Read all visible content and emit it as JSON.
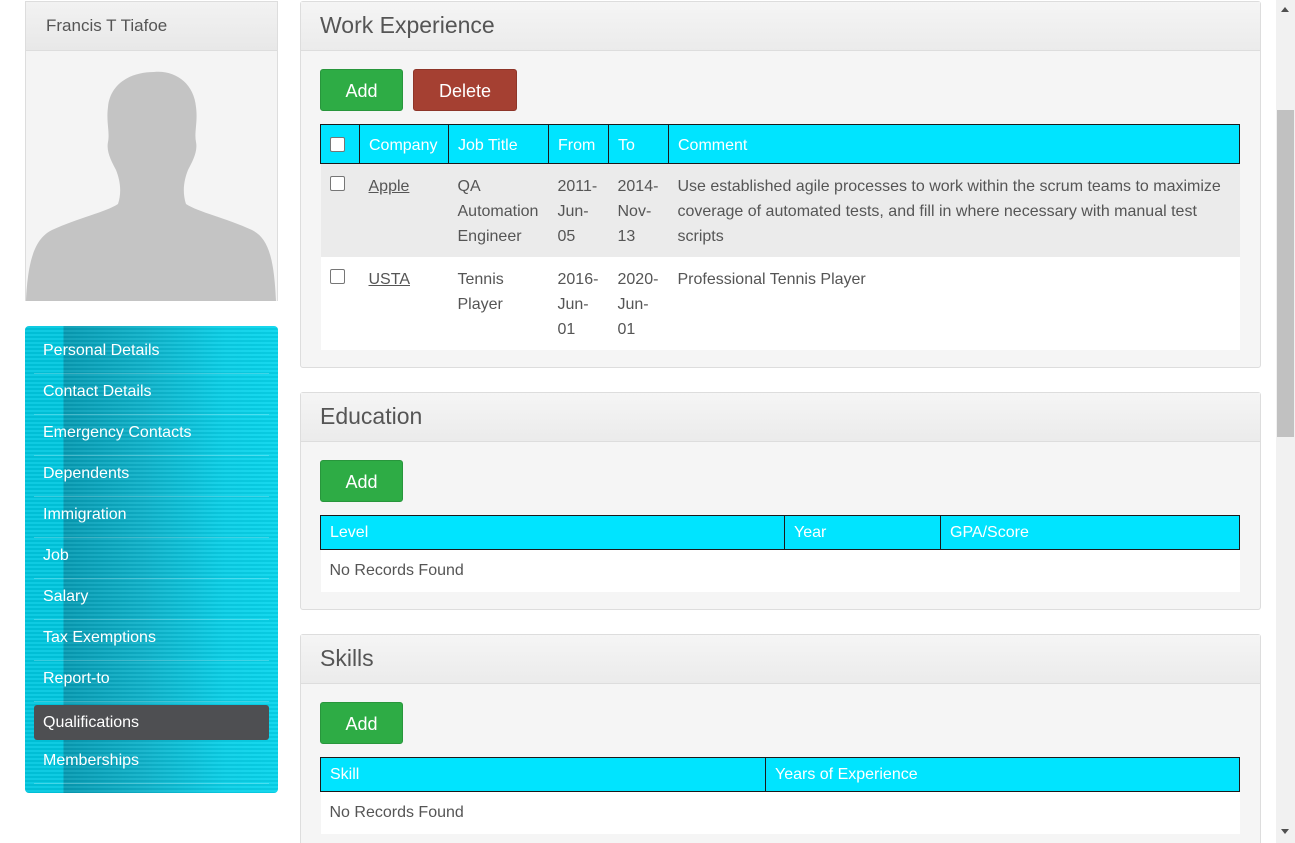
{
  "profile": {
    "name": "Francis T Tiafoe",
    "avatar_icon": "default-person-silhouette"
  },
  "sidebar": {
    "items": [
      {
        "label": "Personal Details"
      },
      {
        "label": "Contact Details"
      },
      {
        "label": "Emergency Contacts"
      },
      {
        "label": "Dependents"
      },
      {
        "label": "Immigration"
      },
      {
        "label": "Job"
      },
      {
        "label": "Salary"
      },
      {
        "label": "Tax Exemptions"
      },
      {
        "label": "Report-to"
      },
      {
        "label": "Qualifications",
        "active": true
      },
      {
        "label": "Memberships"
      }
    ]
  },
  "work_experience": {
    "title": "Work Experience",
    "add_label": "Add",
    "delete_label": "Delete",
    "columns": [
      "Company",
      "Job Title",
      "From",
      "To",
      "Comment"
    ],
    "rows": [
      {
        "company": "Apple",
        "job_title": [
          "QA",
          "Automation",
          "Engineer"
        ],
        "from": [
          "2011-",
          "Jun-",
          "05"
        ],
        "to": [
          "2014-",
          "Nov-",
          "13"
        ],
        "comment": "Use established agile processes to work within the scrum teams to maximize coverage of automated tests, and fill in where necessary with manual test scripts"
      },
      {
        "company": "USTA",
        "job_title": [
          "Tennis",
          "Player"
        ],
        "from": [
          "2016-",
          "Jun-",
          "01"
        ],
        "to": [
          "2020-",
          "Jun-",
          "01"
        ],
        "comment": "Professional Tennis Player"
      }
    ]
  },
  "education": {
    "title": "Education",
    "add_label": "Add",
    "columns": [
      "Level",
      "Year",
      "GPA/Score"
    ],
    "empty_text": "No Records Found"
  },
  "skills": {
    "title": "Skills",
    "add_label": "Add",
    "columns": [
      "Skill",
      "Years of Experience"
    ],
    "empty_text": "No Records Found"
  },
  "colors": {
    "accent_cyan": "#00e4ff",
    "add_green": "#2eac45",
    "delete_red": "#a54032",
    "active_nav": "#4e4f52"
  }
}
